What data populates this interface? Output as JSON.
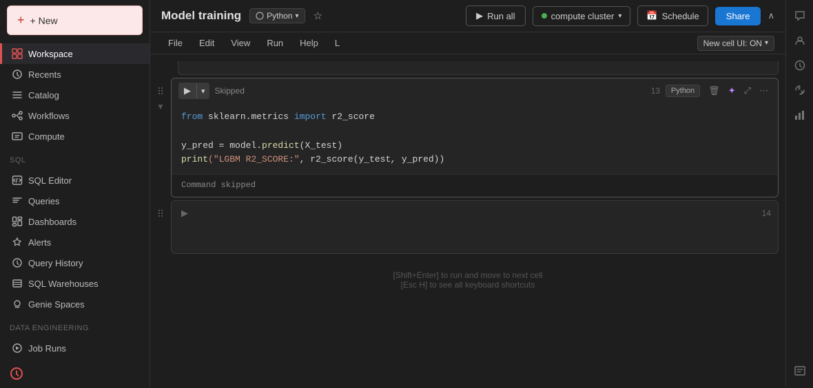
{
  "sidebar": {
    "new_button": "+ New",
    "items": [
      {
        "id": "workspace",
        "label": "Workspace",
        "icon": "workspace",
        "active": true
      },
      {
        "id": "recents",
        "label": "Recents",
        "icon": "recents"
      },
      {
        "id": "catalog",
        "label": "Catalog",
        "icon": "catalog"
      },
      {
        "id": "workflows",
        "label": "Workflows",
        "icon": "workflows"
      },
      {
        "id": "compute",
        "label": "Compute",
        "icon": "compute"
      }
    ],
    "sql_section": "SQL",
    "sql_items": [
      {
        "id": "sql-editor",
        "label": "SQL Editor",
        "icon": "sql-editor"
      },
      {
        "id": "queries",
        "label": "Queries",
        "icon": "queries"
      },
      {
        "id": "dashboards",
        "label": "Dashboards",
        "icon": "dashboards"
      },
      {
        "id": "alerts",
        "label": "Alerts",
        "icon": "alerts"
      },
      {
        "id": "query-history",
        "label": "Query History",
        "icon": "query-history"
      },
      {
        "id": "sql-warehouses",
        "label": "SQL Warehouses",
        "icon": "sql-warehouses"
      },
      {
        "id": "genie-spaces",
        "label": "Genie Spaces",
        "icon": "genie-spaces"
      }
    ],
    "data_engineering_section": "Data Engineering",
    "de_items": [
      {
        "id": "job-runs",
        "label": "Job Runs",
        "icon": "job-runs"
      }
    ]
  },
  "topbar": {
    "title": "Model training",
    "language": "Python",
    "run_all": "Run all",
    "compute": "compute cluster",
    "schedule": "Schedule",
    "share": "Share"
  },
  "menubar": {
    "items": [
      "File",
      "Edit",
      "View",
      "Run",
      "Help",
      "L"
    ],
    "new_cell_toggle": "New cell UI: ON"
  },
  "cells": [
    {
      "id": 13,
      "status": "Skipped",
      "language": "Python",
      "lines": [
        {
          "type": "code",
          "tokens": [
            {
              "class": "kw",
              "text": "from"
            },
            {
              "class": "normal",
              "text": " sklearn.metrics "
            },
            {
              "class": "kw",
              "text": "import"
            },
            {
              "class": "normal",
              "text": " r2_score"
            }
          ]
        },
        {
          "type": "blank"
        },
        {
          "type": "code",
          "tokens": [
            {
              "class": "normal",
              "text": "y_pred = model."
            },
            {
              "class": "fn",
              "text": "predict"
            },
            {
              "class": "normal",
              "text": "(X_test)"
            }
          ]
        },
        {
          "type": "code",
          "tokens": [
            {
              "class": "fn",
              "text": "print"
            },
            {
              "class": "str",
              "text": "("
            },
            {
              "class": "str",
              "text": "\"LGBM R2_SCORE:\""
            },
            {
              "class": "normal",
              "text": ", r2_score(y_test, y_pred))"
            }
          ]
        }
      ],
      "output": "Command skipped"
    },
    {
      "id": 14,
      "status": "",
      "language": "",
      "lines": [],
      "output": ""
    }
  ],
  "hints": {
    "line1": "[Shift+Enter] to run and move to next cell",
    "line2": "[Esc H] to see all keyboard shortcuts"
  },
  "right_sidebar": {
    "buttons": [
      "chat",
      "person",
      "history",
      "code",
      "chart",
      "scroll"
    ]
  }
}
